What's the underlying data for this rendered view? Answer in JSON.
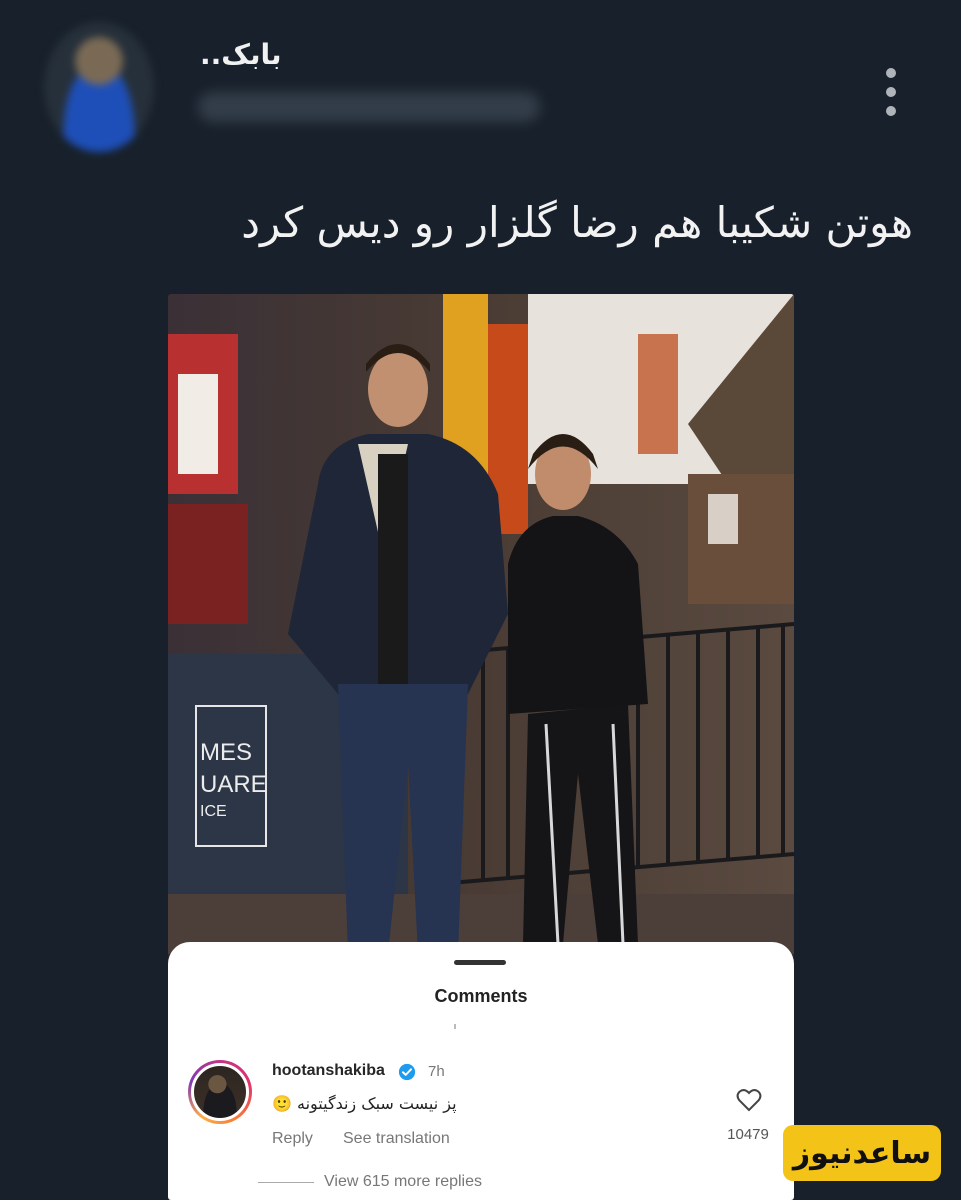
{
  "tweet": {
    "author_name": "بابک..",
    "text": "هوتن شکیبا هم رضا گلزار رو دیس کرد"
  },
  "embedded_photo": {
    "sign_text": [
      "MES",
      "UARE",
      "ICE"
    ]
  },
  "comments_sheet": {
    "title": "Comments",
    "comment": {
      "username": "hootanshakiba",
      "verified": true,
      "time": "7h",
      "text": "پز نیست سبک زندگیتونه 🙂",
      "reply_label": "Reply",
      "translate_label": "See translation",
      "likes": "10479"
    },
    "view_replies": "View 615 more replies"
  },
  "watermark": {
    "text": "ساعدنیوز"
  },
  "colors": {
    "background": "#18212b",
    "watermark_bg": "#f3c318",
    "verified_blue": "#1d9bf0"
  }
}
